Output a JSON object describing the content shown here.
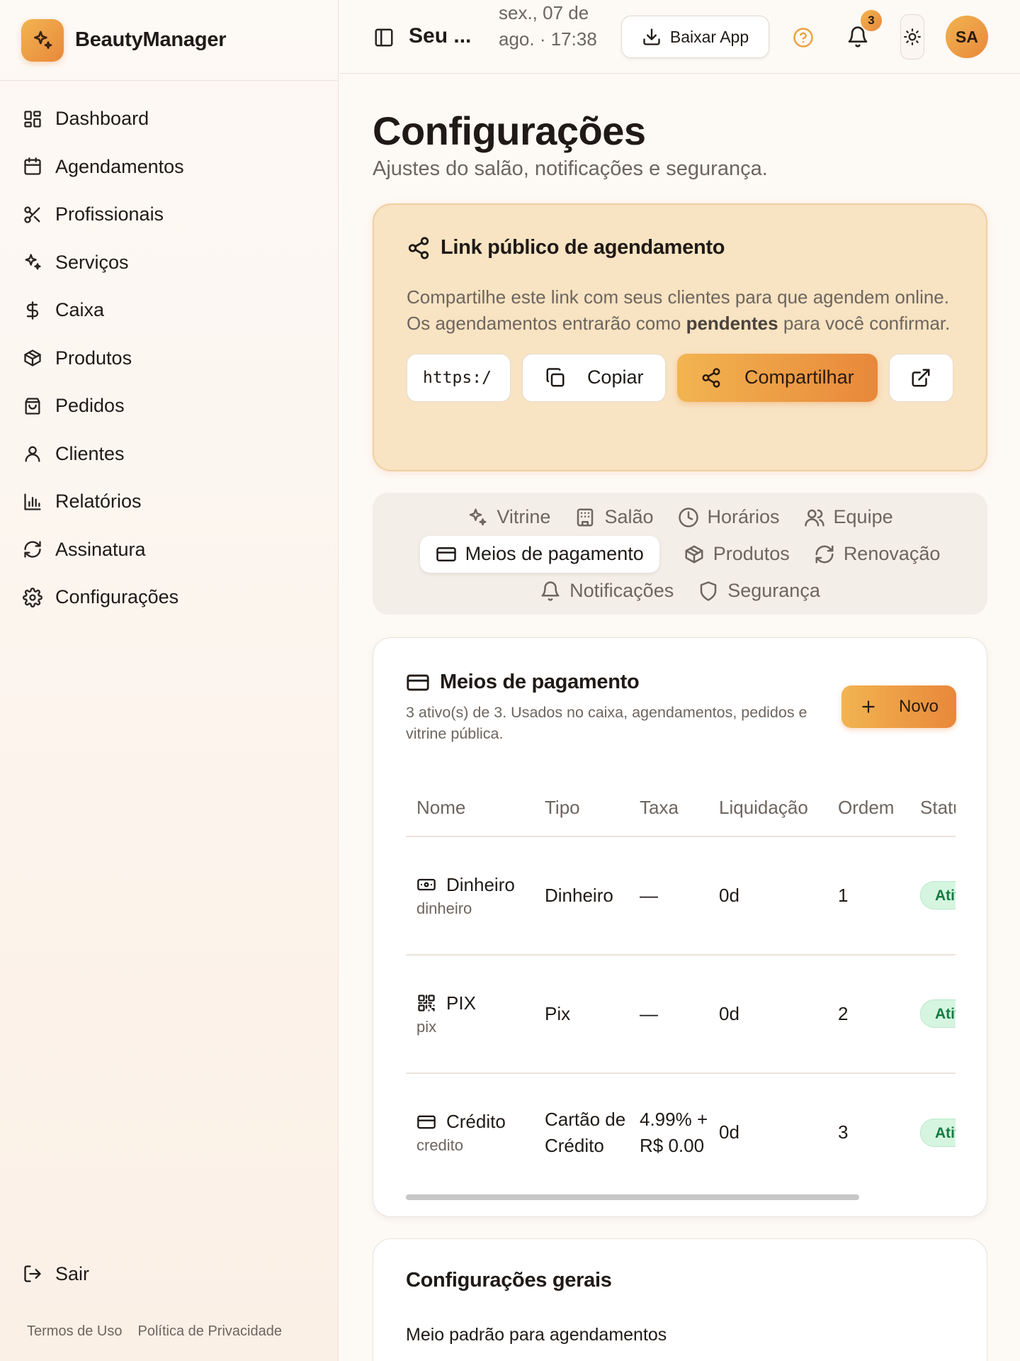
{
  "brand": {
    "name": "BeautyManager"
  },
  "sidebar": {
    "items": [
      {
        "label": "Dashboard",
        "icon": "layout-dashboard-icon"
      },
      {
        "label": "Agendamentos",
        "icon": "calendar-icon"
      },
      {
        "label": "Profissionais",
        "icon": "scissors-icon"
      },
      {
        "label": "Serviços",
        "icon": "sparkles-icon"
      },
      {
        "label": "Caixa",
        "icon": "dollar-icon"
      },
      {
        "label": "Produtos",
        "icon": "package-icon"
      },
      {
        "label": "Pedidos",
        "icon": "shopping-bag-icon"
      },
      {
        "label": "Clientes",
        "icon": "user-icon"
      },
      {
        "label": "Relatórios",
        "icon": "bar-chart-icon"
      },
      {
        "label": "Assinatura",
        "icon": "refresh-icon"
      },
      {
        "label": "Configurações",
        "icon": "settings-icon"
      }
    ],
    "logout": "Sair",
    "terms": "Termos de Uso",
    "privacy": "Política de Privacidade"
  },
  "header": {
    "title": "Seu ...",
    "date": "sex., 07 de ago. · 17:38",
    "download_label": "Baixar App",
    "notification_count": "3",
    "avatar": "SA"
  },
  "page": {
    "title": "Configurações",
    "subtitle": "Ajustes do salão, notificações e segurança."
  },
  "public_link": {
    "title": "Link público de agendamento",
    "desc_before": "Compartilhe este link com seus clientes para que agendem online. Os agendamentos entrarão como ",
    "desc_bold": "pendentes",
    "desc_after": " para você confirmar.",
    "url": "https:/",
    "copy_label": "Copiar",
    "share_label": "Compartilhar"
  },
  "tabs": [
    {
      "label": "Vitrine",
      "icon": "sparkles-icon"
    },
    {
      "label": "Salão",
      "icon": "building-icon"
    },
    {
      "label": "Horários",
      "icon": "clock-icon"
    },
    {
      "label": "Equipe",
      "icon": "users-icon"
    },
    {
      "label": "Meios de pagamento",
      "icon": "credit-card-icon",
      "active": true
    },
    {
      "label": "Produtos",
      "icon": "package-icon"
    },
    {
      "label": "Renovação",
      "icon": "refresh-icon"
    },
    {
      "label": "Notificações",
      "icon": "bell-icon"
    },
    {
      "label": "Segurança",
      "icon": "shield-icon"
    }
  ],
  "payment_methods": {
    "title": "Meios de pagamento",
    "description": "3 ativo(s) de 3. Usados no caixa, agendamentos, pedidos e vitrine pública.",
    "new_label": "Novo",
    "columns": [
      "Nome",
      "Tipo",
      "Taxa",
      "Liquidação",
      "Ordem",
      "Status"
    ],
    "rows": [
      {
        "name": "Dinheiro",
        "slug": "dinheiro",
        "type": "Dinheiro",
        "fee": "—",
        "settlement": "0d",
        "order": "1",
        "status": "Ativo",
        "icon": "banknote-icon"
      },
      {
        "name": "PIX",
        "slug": "pix",
        "type": "Pix",
        "fee": "—",
        "settlement": "0d",
        "order": "2",
        "status": "Ativo",
        "icon": "qr-code-icon"
      },
      {
        "name": "Crédito",
        "slug": "credito",
        "type": "Cartão de Crédito",
        "fee": "4.99% + R$ 0.00",
        "settlement": "0d",
        "order": "3",
        "status": "Ativo",
        "icon": "credit-card-icon"
      }
    ]
  },
  "general": {
    "title": "Configurações gerais",
    "default_method_label": "Meio padrão para agendamentos"
  },
  "colors": {
    "accent_start": "#f2b451",
    "accent_end": "#e8883a",
    "link_card_bg": "#f8e3c2",
    "status_bg": "#d6f5e0",
    "status_text": "#157a40"
  }
}
